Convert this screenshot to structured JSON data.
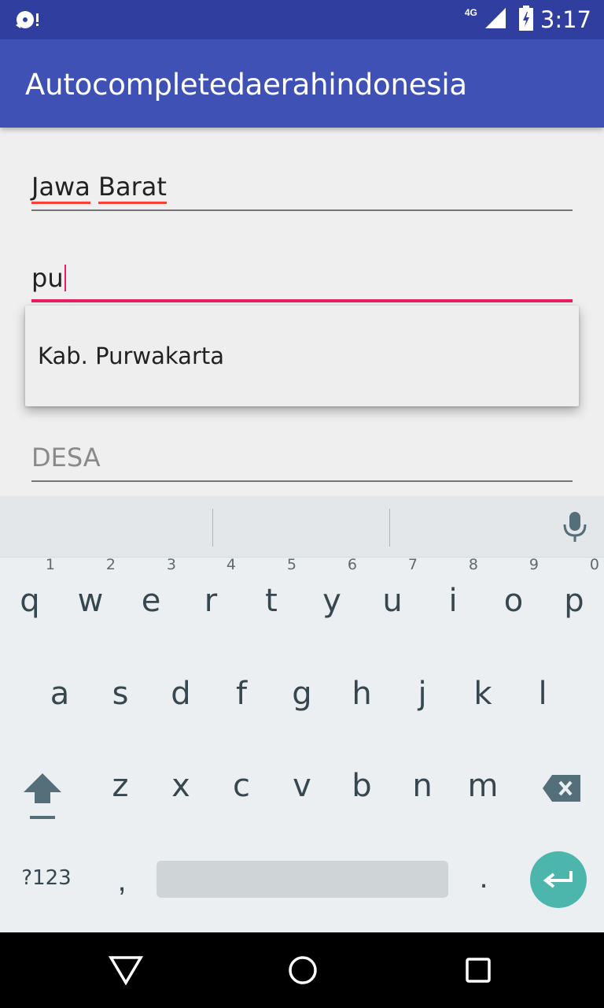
{
  "status_bar": {
    "time": "3:17",
    "network": "4G",
    "icons": [
      "sync-icon",
      "signal-icon",
      "battery-icon"
    ]
  },
  "app_bar": {
    "title": "Autocompletedaerahindonesia"
  },
  "form": {
    "province_word1": "Jawa",
    "province_word2": "Barat",
    "city_value": "pu",
    "desa_placeholder": "DESA"
  },
  "dropdown": {
    "items": [
      "Kab. Purwakarta"
    ]
  },
  "keyboard": {
    "row1": [
      {
        "key": "q",
        "hint": "1"
      },
      {
        "key": "w",
        "hint": "2"
      },
      {
        "key": "e",
        "hint": "3"
      },
      {
        "key": "r",
        "hint": "4"
      },
      {
        "key": "t",
        "hint": "5"
      },
      {
        "key": "y",
        "hint": "6"
      },
      {
        "key": "u",
        "hint": "7"
      },
      {
        "key": "i",
        "hint": "8"
      },
      {
        "key": "o",
        "hint": "9"
      },
      {
        "key": "p",
        "hint": "0"
      }
    ],
    "row2": [
      "a",
      "s",
      "d",
      "f",
      "g",
      "h",
      "j",
      "k",
      "l"
    ],
    "row3": [
      "z",
      "x",
      "c",
      "v",
      "b",
      "n",
      "m"
    ],
    "symbols_label": "?123",
    "comma": ",",
    "period": "."
  },
  "colors": {
    "primary": "#3f51b5",
    "primary_dark": "#303f9f",
    "accent": "#e91e63",
    "enter_key": "#4db6ac"
  }
}
